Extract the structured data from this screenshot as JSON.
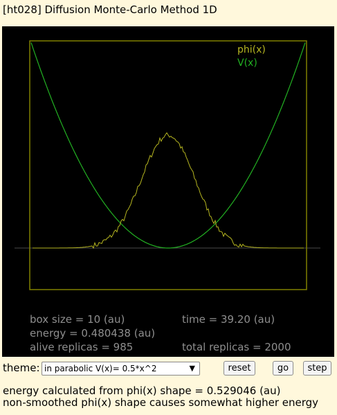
{
  "title": "[ht028] Diffusion Monte-Carlo Method 1D",
  "canvas": {
    "background": "#000000",
    "box_color": "#808000",
    "legend": [
      {
        "label": "phi(x)",
        "color": "#b5b520"
      },
      {
        "label": "V(x)",
        "color": "#22b022"
      }
    ]
  },
  "info": {
    "box_size": "box size = 10 (au)",
    "time": "time = 39.20 (au)",
    "energy": "energy = 0.480438 (au)",
    "alive_replicas": "alive replicas = 985",
    "total_replicas": "total replicas = 2000"
  },
  "controls": {
    "theme_label": "theme:",
    "theme_selected": "in parabolic V(x)= 0.5*x^2",
    "reset_label": "reset",
    "go_label": "go",
    "step_label": "step"
  },
  "notes": {
    "line1": "energy calculated from phi(x) shape = 0.529046 (au)",
    "line2": "non-smoothed phi(x) shape causes somewhat higher energy"
  }
}
